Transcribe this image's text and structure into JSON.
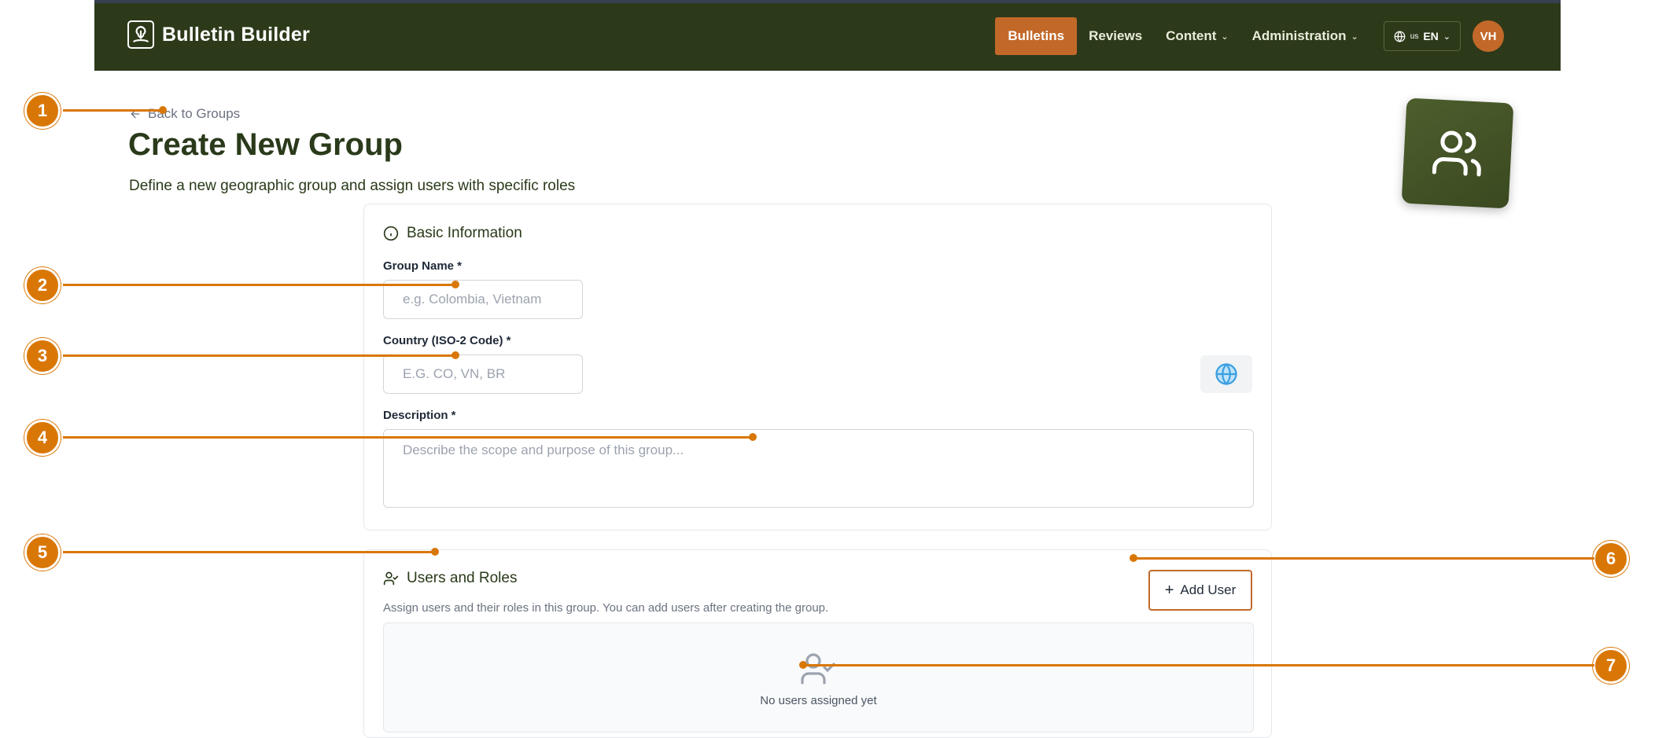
{
  "app": {
    "name": "Bulletin Builder",
    "nav": [
      {
        "label": "Bulletins",
        "active": true
      },
      {
        "label": "Reviews"
      },
      {
        "label": "Content"
      },
      {
        "label": "Administration"
      }
    ],
    "lang_flag": "us",
    "lang_code": "EN",
    "avatar_initials": "VH"
  },
  "page": {
    "back_label": "Back to Groups",
    "title": "Create New Group",
    "subtitle": "Define a new geographic group and assign users with specific roles"
  },
  "basic_info": {
    "title": "Basic Information",
    "group_name_label": "Group Name *",
    "group_name_placeholder": "e.g. Colombia, Vietnam",
    "country_label": "Country (ISO-2 Code) *",
    "country_placeholder": "E.G. CO, VN, BR",
    "description_label": "Description *",
    "description_placeholder": "Describe the scope and purpose of this group..."
  },
  "users_roles": {
    "title": "Users and Roles",
    "description": "Assign users and their roles in this group. You can add users after creating the group.",
    "add_user_label": "Add User",
    "empty_text": "No users assigned yet"
  },
  "callouts": [
    "1",
    "2",
    "3",
    "4",
    "5",
    "6",
    "7"
  ],
  "colors": {
    "topbar": "#2d3a1a",
    "accent": "#c2692a",
    "callout": "#d97706",
    "heading": "#2a3a1a"
  }
}
